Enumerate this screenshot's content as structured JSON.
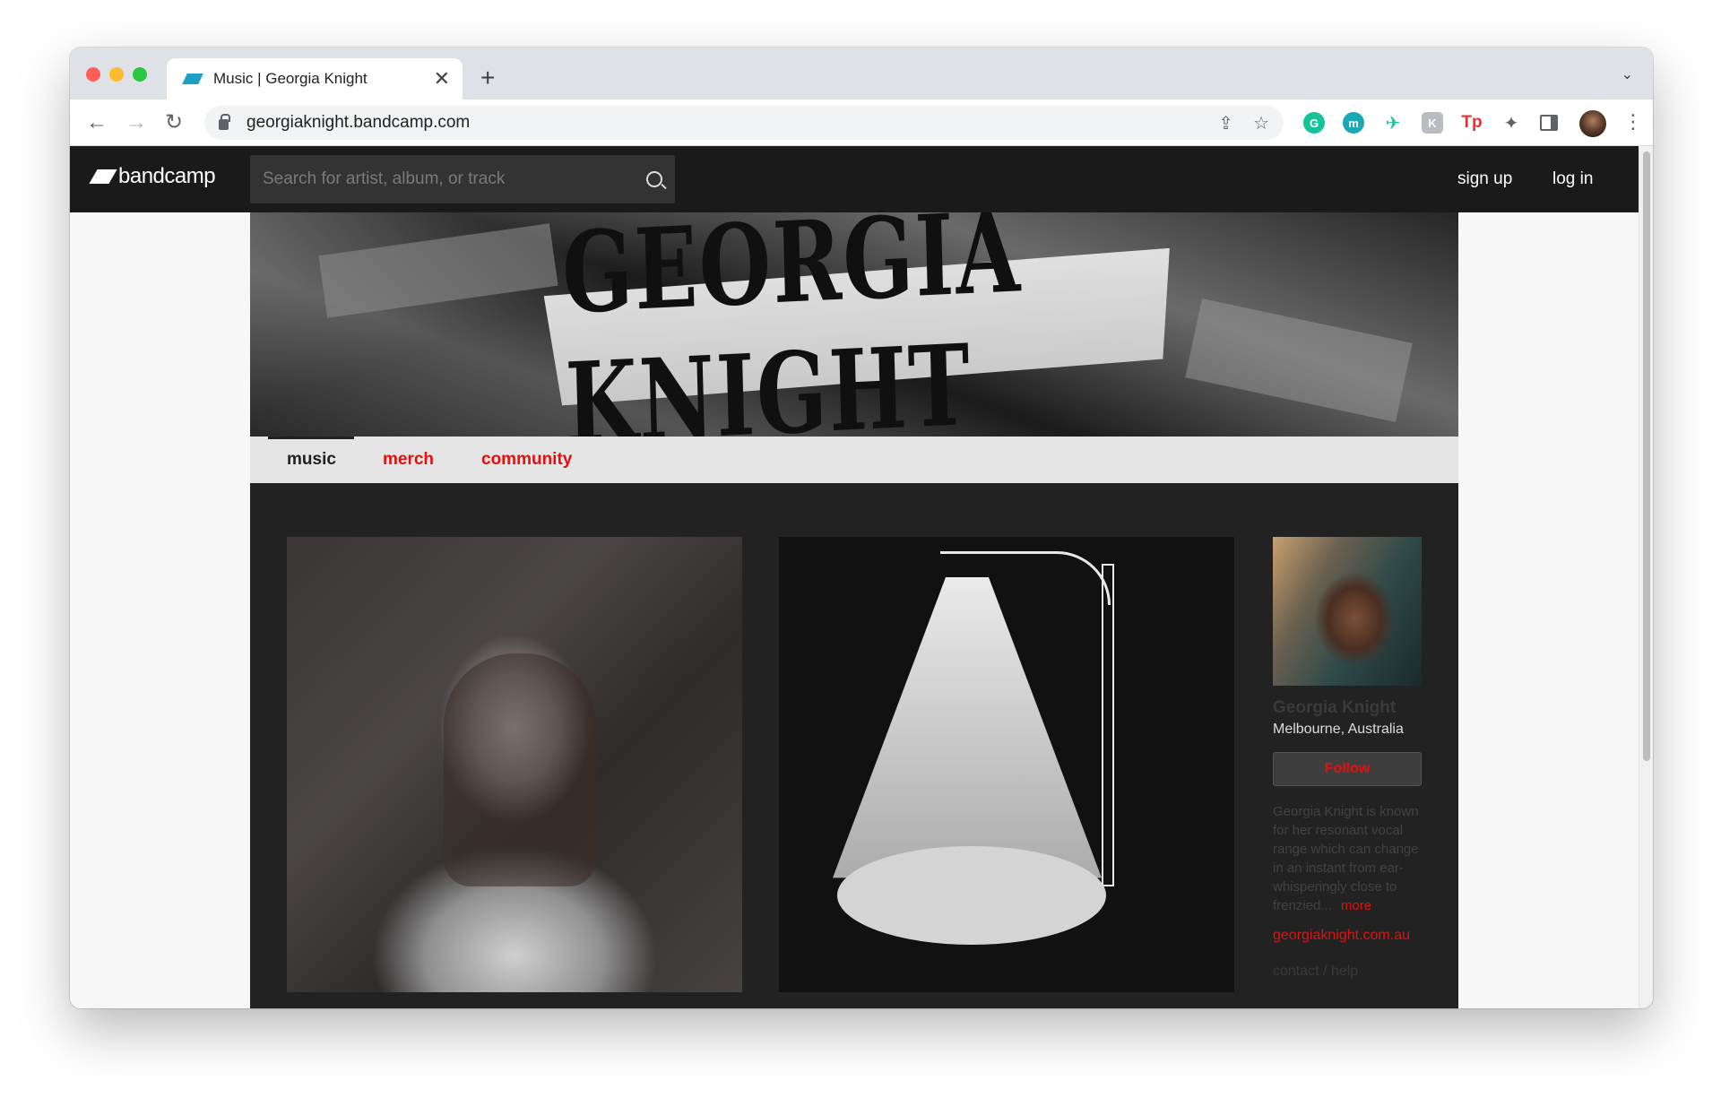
{
  "browser": {
    "tab_title": "Music | Georgia Knight",
    "tab_close": "✕",
    "new_tab": "+",
    "tabs_menu": "⌄",
    "back": "←",
    "forward": "→",
    "reload": "↻",
    "url": "georgiaknight.bandcamp.com",
    "share_icon": "⇪",
    "bookmark_icon": "☆",
    "extensions": [
      {
        "name": "grammarly-icon",
        "glyph": "G"
      },
      {
        "name": "m-extension-icon",
        "glyph": "m"
      },
      {
        "name": "bird-extension-icon",
        "glyph": "✈"
      },
      {
        "name": "k-extension-icon",
        "glyph": "K"
      },
      {
        "name": "tp-extension-icon",
        "glyph": "Tp"
      },
      {
        "name": "puzzle-icon",
        "glyph": "✦"
      }
    ],
    "menu": "⋮"
  },
  "bandcamp": {
    "logo": "bandcamp",
    "search_placeholder": "Search for artist, album, or track",
    "signup": "sign up",
    "login": "log in"
  },
  "banner": {
    "title": "GEORGIA KNIGHT"
  },
  "nav": {
    "music": "music",
    "merch": "merch",
    "community": "community"
  },
  "artist": {
    "name": "Georgia Knight",
    "location": "Melbourne, Australia",
    "follow": "Follow",
    "bio": "Georgia Knight is known for her resonant vocal range which can change in an instant from ear-whisperingly close to frenzied...",
    "more": "more",
    "site": "georgiaknight.com.au",
    "contact": "contact / help"
  },
  "colors": {
    "accent": "#e0110f",
    "header_bg": "#1a1a1a",
    "page_bg": "#222222"
  }
}
